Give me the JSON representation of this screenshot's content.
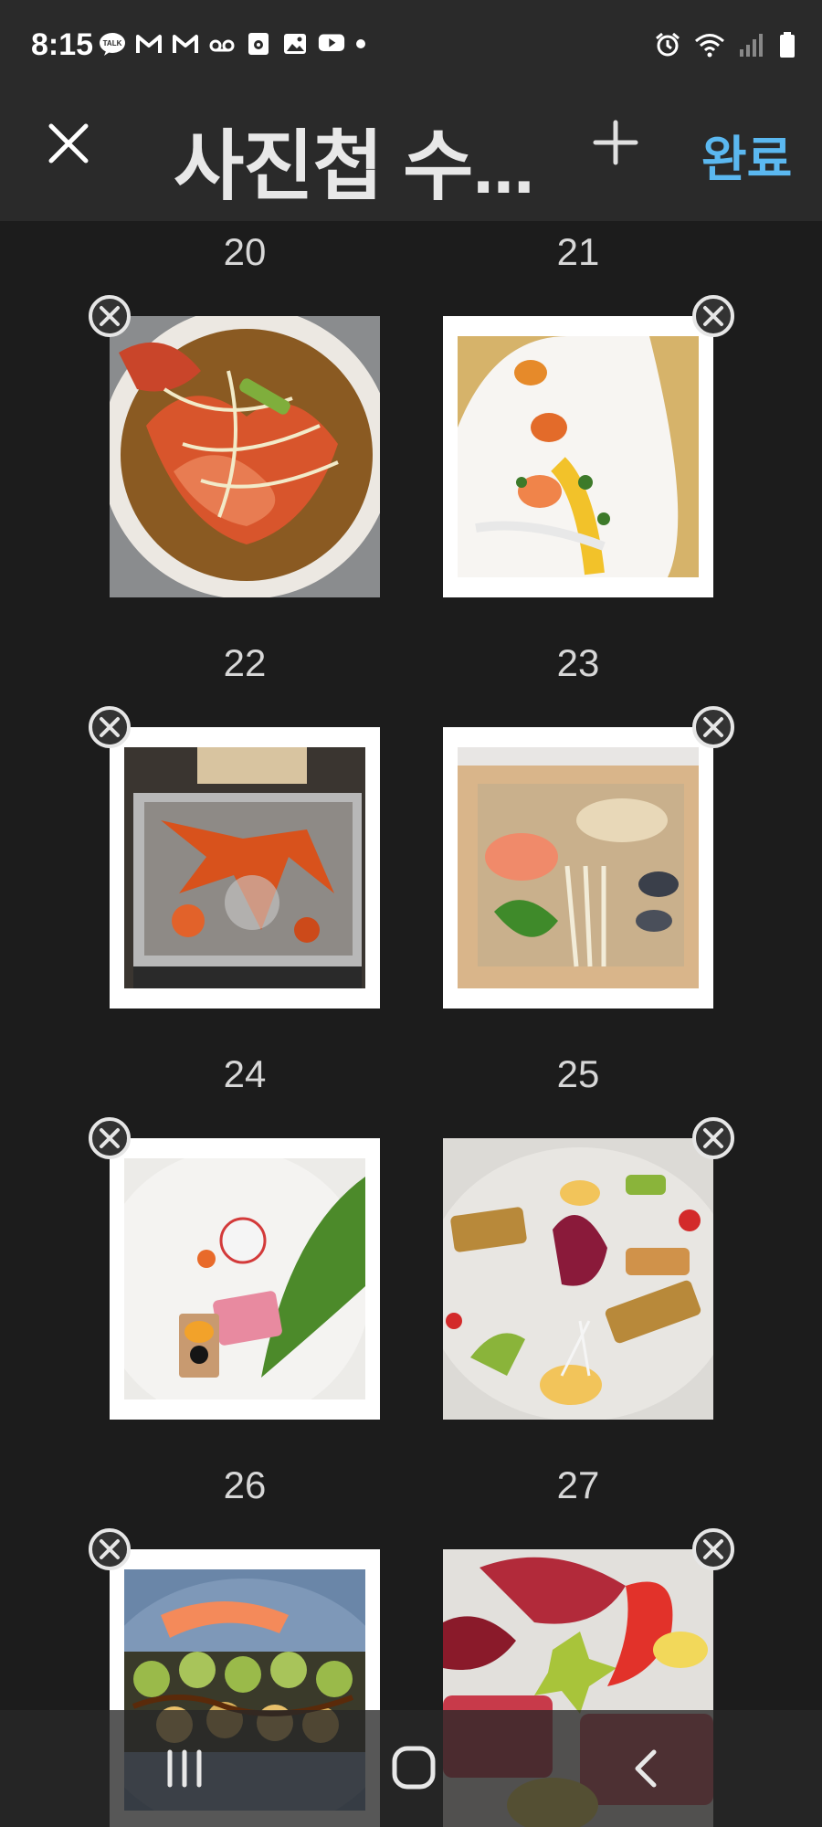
{
  "status_bar": {
    "time": "8:15",
    "left_icons": [
      "kakaotalk-icon",
      "gmail-icon",
      "gmail-icon",
      "voicemail-icon",
      "calendar-icon",
      "gallery-icon",
      "youtube-icon",
      "dot-icon"
    ],
    "right_icons": [
      "alarm-icon",
      "wifi-icon",
      "signal-icon",
      "battery-icon"
    ]
  },
  "header": {
    "title": "사진첩 수...",
    "close_icon": "close-icon",
    "add_icon": "plus-icon",
    "done_label": "완료",
    "done_color": "#5bb8f0"
  },
  "photos": [
    {
      "number": "20",
      "subject": "lobster soup"
    },
    {
      "number": "21",
      "subject": "plated seafood"
    },
    {
      "number": "22",
      "subject": "steamed crayfish tray"
    },
    {
      "number": "23",
      "subject": "steamed seafood basket"
    },
    {
      "number": "24",
      "subject": "tuna sashimi"
    },
    {
      "number": "25",
      "subject": "seared salmon plate"
    },
    {
      "number": "26",
      "subject": "sushi rolls"
    },
    {
      "number": "27",
      "subject": "tuna platter"
    }
  ],
  "remove_icon": "remove-circle-icon",
  "navbar": {
    "recent_icon": "recent-apps-icon",
    "home_icon": "home-icon",
    "back_icon": "back-icon"
  }
}
